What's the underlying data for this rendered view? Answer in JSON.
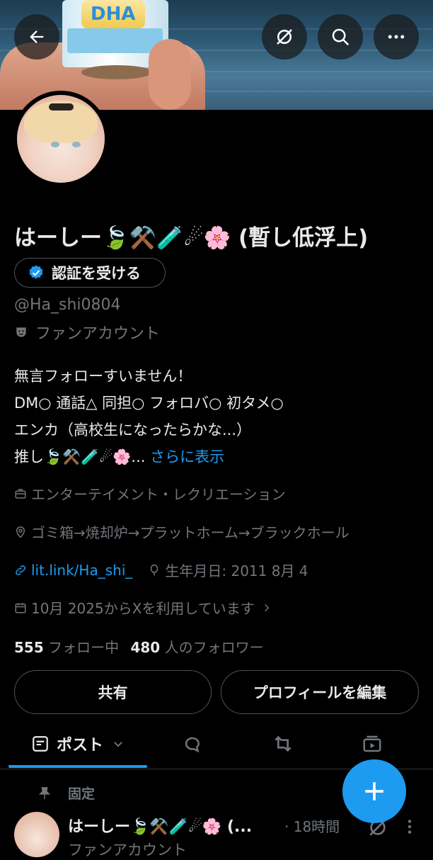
{
  "banner": {
    "can_text": "DHA"
  },
  "topbar": {
    "back": "back-arrow-icon",
    "grok": "grok-icon",
    "search": "search-icon",
    "more": "more-icon"
  },
  "profile": {
    "name": "はーしー🍃⚒️🧪☄🌸 (暫し低浮上)",
    "verify_label": "認証を受ける",
    "handle": "@Ha_shi0804",
    "account_type": "ファンアカウント",
    "bio": [
      "無言フォローすいません！",
      "DM○ 通話△ 同担○ フォロバ○ 初タメ○",
      "エンカ（高校生になったらかな...）",
      "推し🍃⚒️🧪☄🌸..."
    ],
    "bio_more": " さらに表示",
    "category": "エンターテイメント・レクリエーション",
    "location": "ゴミ箱→焼却炉→プラットホーム→ブラックホール",
    "website": "lit.link/Ha_shi_",
    "birthday": "生年月日: 2011 8月 4",
    "joined": "10月 2025からXを利用しています",
    "following_count": "555",
    "following_label": " フォロー中",
    "followers_count": "480",
    "followers_label": " 人のフォロワー"
  },
  "buttons": {
    "share": "共有",
    "edit": "プロフィールを編集"
  },
  "tabs": {
    "posts": "ポスト"
  },
  "pinned": {
    "label": "固定",
    "name": "はーしー🍃⚒️🧪☄🌸 (...",
    "time": "· 18時間",
    "sub": "ファンアカウント"
  },
  "colors": {
    "accent": "#1d9bf0",
    "background": "#000000",
    "muted": "#71767b"
  }
}
